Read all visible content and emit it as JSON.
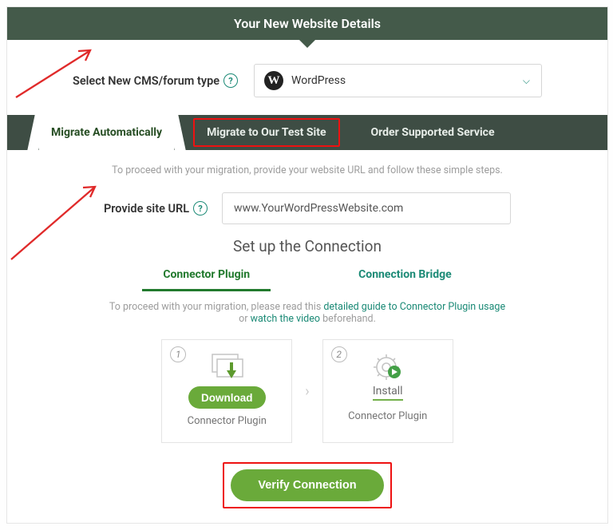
{
  "header": {
    "title": "Your New Website Details"
  },
  "cms": {
    "label": "Select New CMS/forum type",
    "selected": "WordPress"
  },
  "tabs": [
    {
      "label": "Migrate Automatically"
    },
    {
      "label": "Migrate to Our Test Site"
    },
    {
      "label": "Order Supported Service"
    }
  ],
  "proceed_text": {
    "pre": "To proceed with your migration, provide your website URL and follow these simple steps."
  },
  "url": {
    "label": "Provide site URL",
    "value": "www.YourWordPressWebsite.com"
  },
  "setup_title": "Set up the Connection",
  "subtabs": [
    {
      "label": "Connector Plugin"
    },
    {
      "label": "Connection Bridge"
    }
  ],
  "guide": {
    "a": "To proceed with your migration, please read this ",
    "link1": "detailed guide to Connector Plugin usage",
    "b": " or ",
    "link2": "watch the video",
    "c": " beforehand."
  },
  "steps": [
    {
      "num": "1",
      "action": "Download",
      "sub": "Connector Plugin"
    },
    {
      "num": "2",
      "action": "Install",
      "sub": "Connector Plugin"
    }
  ],
  "verify": {
    "label": "Verify Connection"
  }
}
